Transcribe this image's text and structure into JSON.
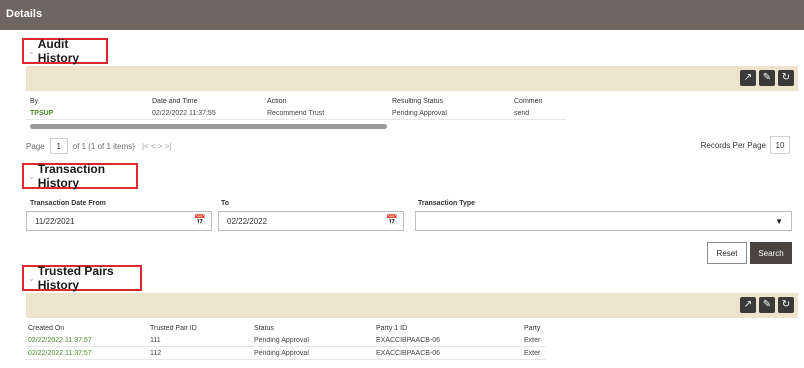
{
  "header": {
    "title": "Details"
  },
  "audit": {
    "title": "Audit History",
    "columns": [
      "By",
      "Date and Time",
      "Action",
      "Resulting Status",
      "Commen"
    ],
    "rows": [
      [
        "TPSUP",
        "02/22/2022 11:37:55",
        "Recommend Trust",
        "Pending Approval",
        "send"
      ]
    ],
    "pager": {
      "page_label": "Page",
      "page_value": "1",
      "of_text": "of 1  (1 of 1 items)",
      "nav": "|<  <  >  >|",
      "records_label": "Records Per Page",
      "records_value": "10"
    }
  },
  "transaction": {
    "title": "Transaction History",
    "from_label": "Transaction Date From",
    "from_value": "11/22/2021",
    "to_label": "To",
    "to_value": "02/22/2022",
    "type_label": "Transaction Type",
    "type_value": "",
    "reset": "Reset",
    "search": "Search"
  },
  "trusted": {
    "title": "Trusted Pairs History",
    "columns": [
      "Created On",
      "Trusted Pair ID",
      "Status",
      "Party 1 ID",
      "Party"
    ],
    "rows": [
      [
        "02/22/2022 11:37:57",
        "111",
        "Pending Approval",
        "EXACCIBPAACB-06",
        "Exter"
      ],
      [
        "02/22/2022 11:37:57",
        "112",
        "Pending Approval",
        "EXACCIBPAACB-06",
        "Exter"
      ]
    ]
  },
  "icons": {
    "chevron": "chevron-down-icon",
    "export": "export-icon",
    "share": "share-icon",
    "refresh": "refresh-icon",
    "calendar": "calendar-icon",
    "dropdown": "dropdown-arrow-icon"
  },
  "colors": {
    "header_bg": "#6e6460",
    "toolbar_bg": "#ece4cd",
    "highlight_border": "#e0262e",
    "link_green": "#4a8a2a"
  }
}
